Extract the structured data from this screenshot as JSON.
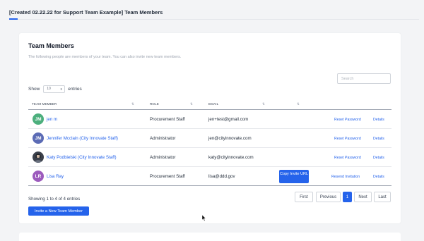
{
  "header": {
    "title": "[Created 02.22.22 for Support Team Example] Team Members"
  },
  "team": {
    "title": "Team Members",
    "subtitle": "The following people are members of your team. You can also invite new team members.",
    "search_placeholder": "Search",
    "show_label": "Show",
    "entries_value": "10",
    "entries_label": "entries",
    "columns": [
      "Team Member",
      "Role",
      "Email"
    ],
    "rows": [
      {
        "initials": "JM",
        "avatar_color": "#4caf7d",
        "name": "jen m",
        "role": "Procurement Staff",
        "email": "jen+test@gmail.com",
        "action1": "Reset Password",
        "action2": "Details"
      },
      {
        "initials": "JM",
        "avatar_color": "#5b6bb5",
        "name": "Jennifer Mcclain (City Innovate Staff)",
        "role": "Administrator",
        "email": "jen@cityinnovate.com",
        "action1": "Reset Password",
        "action2": "Details"
      },
      {
        "initials": "",
        "avatar_color": "#3a3f4a",
        "name": "Katy Podbielski (City Innovate Staff)",
        "role": "Administrator",
        "email": "katy@cityinnovate.com",
        "action1": "Reset Password",
        "action2": "Details"
      },
      {
        "initials": "LR",
        "avatar_color": "#9c5bbd",
        "name": "Lisa Ray",
        "role": "Procurement Staff",
        "email": "lisa@ddd.gov",
        "copy_button": "Copy Invite URL",
        "action1": "Resend Invitation",
        "action2": "Details"
      }
    ],
    "info": "Showing 1 to 4 of 4 entries",
    "pagination": {
      "first": "First",
      "previous": "Previous",
      "current": "1",
      "next": "Next",
      "last": "Last"
    },
    "invite_button": "Invite a New Team Member"
  },
  "colors": {
    "accent": "#2563eb"
  }
}
